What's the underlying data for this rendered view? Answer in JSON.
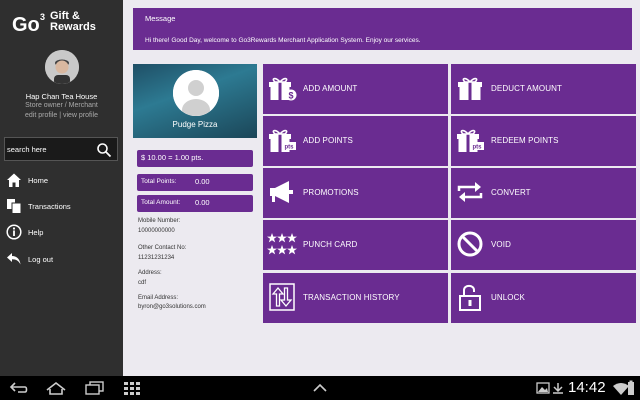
{
  "app": {
    "logo_mark": "Go",
    "logo_super": "3",
    "logo_line1": "Gift &",
    "logo_line2": "Rewards"
  },
  "profile": {
    "name": "Hap Chan Tea House",
    "role": "Store owner / Merchant",
    "links": "edit profile | view profile"
  },
  "search": {
    "placeholder": "search here"
  },
  "nav": {
    "items": [
      {
        "label": "Home",
        "icon": "home-icon"
      },
      {
        "label": "Transactions",
        "icon": "documents-icon"
      },
      {
        "label": "Help",
        "icon": "info-icon"
      },
      {
        "label": "Log out",
        "icon": "logout-arrow-icon"
      }
    ]
  },
  "message": {
    "title": "Message",
    "body": "Hi there! Good Day, welcome to Go3Rewards Merchant Application System. Enjoy our services."
  },
  "merchant": {
    "name": "Pudge Pizza",
    "rate": "$ 10.00 = 1.00 pts.",
    "total_points_label": "Total Points:",
    "total_points_value": "0.00",
    "total_amount_label": "Total Amount:",
    "total_amount_value": "0.00",
    "mobile_label": "Mobile Number:",
    "mobile_value": "10000000000",
    "other_contact_label": "Other Contact No:",
    "other_contact_value": "11231231234",
    "address_label": "Address:",
    "address_value": "cdf",
    "email_label": "Email Address:",
    "email_value": "byron@go3solutions.com"
  },
  "actions": [
    {
      "label": "ADD AMOUNT",
      "icon": "gift-dollar-icon"
    },
    {
      "label": "DEDUCT AMOUNT",
      "icon": "gift-icon"
    },
    {
      "label": "ADD POINTS",
      "icon": "gift-points-icon"
    },
    {
      "label": "REDEEM POINTS",
      "icon": "gift-points-icon"
    },
    {
      "label": "PROMOTIONS",
      "icon": "megaphone-icon"
    },
    {
      "label": "CONVERT",
      "icon": "convert-arrows-icon"
    },
    {
      "label": "PUNCH CARD",
      "icon": "stars-icon"
    },
    {
      "label": "VOID",
      "icon": "prohibited-icon"
    },
    {
      "label": "TRANSACTION HISTORY",
      "icon": "up-down-arrows-icon"
    },
    {
      "label": "UNLOCK",
      "icon": "unlock-icon"
    }
  ],
  "system_bar": {
    "time": "14:42"
  },
  "colors": {
    "accent": "#6a2c91",
    "sidebar": "#2f2f2f",
    "background": "#eceaf0"
  }
}
